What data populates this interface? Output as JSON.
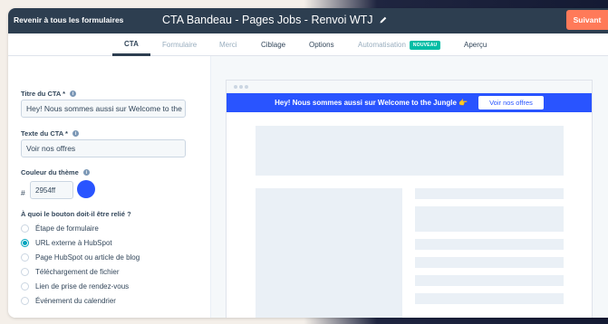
{
  "header": {
    "back_label": "Revenir à tous les formulaires",
    "title": "CTA Bandeau - Pages Jobs - Renvoi WTJ",
    "next_label": "Suivant"
  },
  "tabs": [
    {
      "label": "CTA",
      "state": "active"
    },
    {
      "label": "Formulaire",
      "state": "disabled"
    },
    {
      "label": "Merci",
      "state": "disabled"
    },
    {
      "label": "Ciblage",
      "state": "normal"
    },
    {
      "label": "Options",
      "state": "normal"
    },
    {
      "label": "Automatisation",
      "state": "disabled",
      "badge": "NOUVEAU"
    },
    {
      "label": "Aperçu",
      "state": "normal"
    }
  ],
  "form": {
    "cta_title_label": "Titre du CTA *",
    "cta_title_value": "Hey! Nous sommes aussi sur Welcome to the",
    "cta_text_label": "Texte du CTA *",
    "cta_text_value": "Voir nos offres",
    "theme_label": "Couleur du thème",
    "hash_symbol": "#",
    "theme_hex": "2954ff",
    "link_question": "À quoi le bouton doit-il être relié ?",
    "link_options": [
      {
        "label": "Étape de formulaire",
        "checked": false
      },
      {
        "label": "URL externe à HubSpot",
        "checked": true
      },
      {
        "label": "Page HubSpot ou article de blog",
        "checked": false
      },
      {
        "label": "Téléchargement de fichier",
        "checked": false
      },
      {
        "label": "Lien de prise de rendez-vous",
        "checked": false
      },
      {
        "label": "Événement du calendrier",
        "checked": false
      }
    ]
  },
  "preview": {
    "banner_text": "Hey! Nous sommes aussi sur Welcome to the Jungle 👉",
    "banner_button": "Voir nos offres"
  },
  "colors": {
    "theme": "#2954ff",
    "topbar": "#2d3e50",
    "next_button": "#ff7a59",
    "radio_selected": "#00a4bd",
    "badge": "#00bda5"
  },
  "icons": {
    "title_edit": "pencil-icon",
    "field_help": "info-icon"
  }
}
